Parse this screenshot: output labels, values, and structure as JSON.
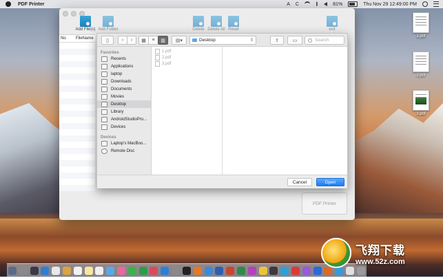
{
  "menubar": {
    "app_name": "PDF Printer",
    "adobe_glyph": "A",
    "c_glyph": "C",
    "battery": "81%",
    "clock": "Thu Nov 29  12:49:00 PM"
  },
  "desktop_files": [
    {
      "label": "1.pdf"
    },
    {
      "label": "2.pdf"
    },
    {
      "label": "3.pdf"
    }
  ],
  "app": {
    "toolbar": [
      {
        "label": "Add File(s)"
      },
      {
        "label": "Add Folder"
      },
      {
        "label": "Delete"
      },
      {
        "label": "Delete All"
      },
      {
        "label": "Reset"
      },
      {
        "label": "exit"
      }
    ],
    "table_headers": [
      "No",
      "FileName"
    ],
    "print_button": "PDF Printer"
  },
  "dialog": {
    "location": "Desktop",
    "search_placeholder": "Search",
    "sidebar": {
      "favorites_title": "Favorites",
      "favorites": [
        "Recents",
        "Applications",
        "laptop",
        "Downloads",
        "Documents",
        "Movies",
        "Desktop",
        "Library",
        "AndroidStudioPro...",
        "Devices"
      ],
      "devices_title": "Devices",
      "devices": [
        "Laptop's MacBoo...",
        "Remote Disc"
      ]
    },
    "files": [
      "1.pdf",
      "2.pdf",
      "3.pdf"
    ],
    "cancel_label": "Cancel",
    "open_label": "Open"
  },
  "watermark": {
    "brand_cn": "飞翔下载",
    "url": "www.52z.com"
  },
  "colors": {
    "accent_blue": "#1c7ef0",
    "toolbar_icon_blue": "#1b7fc0"
  }
}
